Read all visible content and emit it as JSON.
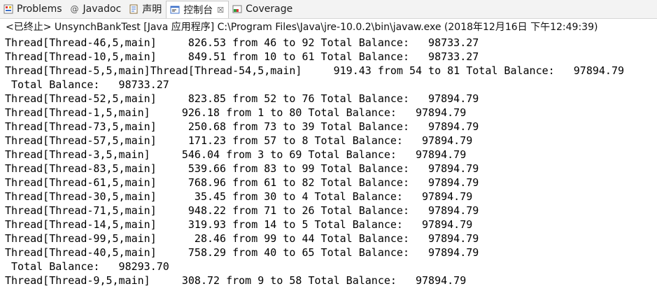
{
  "tabs": [
    {
      "label": "Problems",
      "icon": "problems-icon",
      "active": false
    },
    {
      "label": "Javadoc",
      "icon": "javadoc-icon",
      "active": false
    },
    {
      "label": "声明",
      "icon": "declaration-icon",
      "active": false
    },
    {
      "label": "控制台",
      "icon": "console-icon",
      "active": true,
      "close": "☒"
    },
    {
      "label": "Coverage",
      "icon": "coverage-icon",
      "active": false
    }
  ],
  "console": {
    "header": "<已终止> UnsynchBankTest [Java 应用程序] C:\\Program Files\\Java\\jre-10.0.2\\bin\\javaw.exe  (2018年12月16日 下午12:49:39)",
    "lines": [
      "Thread[Thread-46,5,main]     826.53 from 46 to 92 Total Balance:   98733.27",
      "Thread[Thread-10,5,main]     849.51 from 10 to 61 Total Balance:   98733.27",
      "Thread[Thread-5,5,main]Thread[Thread-54,5,main]     919.43 from 54 to 81 Total Balance:   97894.79",
      " Total Balance:   98733.27",
      "Thread[Thread-52,5,main]     823.85 from 52 to 76 Total Balance:   97894.79",
      "Thread[Thread-1,5,main]     926.18 from 1 to 80 Total Balance:   97894.79",
      "Thread[Thread-73,5,main]     250.68 from 73 to 39 Total Balance:   97894.79",
      "Thread[Thread-57,5,main]     171.23 from 57 to 8 Total Balance:   97894.79",
      "Thread[Thread-3,5,main]     546.04 from 3 to 69 Total Balance:   97894.79",
      "Thread[Thread-83,5,main]     539.66 from 83 to 99 Total Balance:   97894.79",
      "Thread[Thread-61,5,main]     768.96 from 61 to 82 Total Balance:   97894.79",
      "Thread[Thread-30,5,main]      35.45 from 30 to 4 Total Balance:   97894.79",
      "Thread[Thread-71,5,main]     948.22 from 71 to 26 Total Balance:   97894.79",
      "Thread[Thread-14,5,main]     319.93 from 14 to 5 Total Balance:   97894.79",
      "Thread[Thread-99,5,main]      28.46 from 99 to 44 Total Balance:   97894.79",
      "Thread[Thread-40,5,main]     758.29 from 40 to 65 Total Balance:   97894.79",
      " Total Balance:   98293.70",
      "Thread[Thread-9,5,main]     308.72 from 9 to 58 Total Balance:   97894.79"
    ]
  }
}
